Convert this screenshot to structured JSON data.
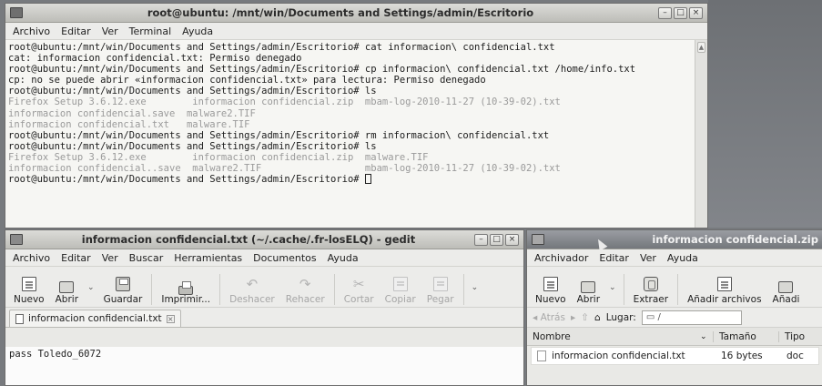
{
  "terminal": {
    "title": "root@ubuntu: /mnt/win/Documents and Settings/admin/Escritorio",
    "menu": [
      "Archivo",
      "Editar",
      "Ver",
      "Terminal",
      "Ayuda"
    ],
    "lines": [
      {
        "text": "root@ubuntu:/mnt/win/Documents and Settings/admin/Escritorio# cat informacion\\ confidencial.txt",
        "dim": false
      },
      {
        "text": "cat: informacion confidencial.txt: Permiso denegado",
        "dim": false
      },
      {
        "text": "root@ubuntu:/mnt/win/Documents and Settings/admin/Escritorio# cp informacion\\ confidencial.txt /home/info.txt",
        "dim": false
      },
      {
        "text": "cp: no se puede abrir «informacion confidencial.txt» para lectura: Permiso denegado",
        "dim": false
      },
      {
        "text": "root@ubuntu:/mnt/win/Documents and Settings/admin/Escritorio# ls",
        "dim": false
      },
      {
        "text": "Firefox Setup 3.6.12.exe        informacion confidencial.zip  mbam-log-2010-11-27 (10-39-02).txt",
        "dim": true
      },
      {
        "text": "informacion confidencial.save  malware2.TIF",
        "dim": true
      },
      {
        "text": "informacion confidencial.txt   malware.TIF",
        "dim": true
      },
      {
        "text": "root@ubuntu:/mnt/win/Documents and Settings/admin/Escritorio# rm informacion\\ confidencial.txt",
        "dim": false
      },
      {
        "text": "root@ubuntu:/mnt/win/Documents and Settings/admin/Escritorio# ls",
        "dim": false
      },
      {
        "text": "Firefox Setup 3.6.12.exe        informacion confidencial.zip  malware.TIF",
        "dim": true
      },
      {
        "text": "informacion confidencial..save  malware2.TIF                  mbam-log-2010-11-27 (10-39-02).txt",
        "dim": true
      },
      {
        "text": "root@ubuntu:/mnt/win/Documents and Settings/admin/Escritorio# ",
        "dim": false,
        "cursor": true
      }
    ]
  },
  "gedit": {
    "title": "informacion confidencial.txt (~/.cache/.fr-losELQ) - gedit",
    "menu": [
      "Archivo",
      "Editar",
      "Ver",
      "Buscar",
      "Herramientas",
      "Documentos",
      "Ayuda"
    ],
    "toolbar": {
      "new": "Nuevo",
      "open": "Abrir",
      "save": "Guardar",
      "print": "Imprimir...",
      "undo": "Deshacer",
      "redo": "Rehacer",
      "cut": "Cortar",
      "copy": "Copiar",
      "paste": "Pegar"
    },
    "tab_label": "informacion confidencial.txt",
    "content": "pass Toledo_6072"
  },
  "archiver": {
    "title": "informacion confidencial.zip",
    "menu": [
      "Archivador",
      "Editar",
      "Ver",
      "Ayuda"
    ],
    "toolbar": {
      "new": "Nuevo",
      "open": "Abrir",
      "extract": "Extraer",
      "add_files": "Añadir archivos",
      "add_folder": "Añadi"
    },
    "nav": {
      "back": "Atrás",
      "location_label": "Lugar:",
      "location_value": "/"
    },
    "columns": [
      "Nombre",
      "Tamaño",
      "Tipo"
    ],
    "rows": [
      {
        "name": "informacion confidencial.txt",
        "size": "16 bytes",
        "type": "doc"
      }
    ]
  }
}
